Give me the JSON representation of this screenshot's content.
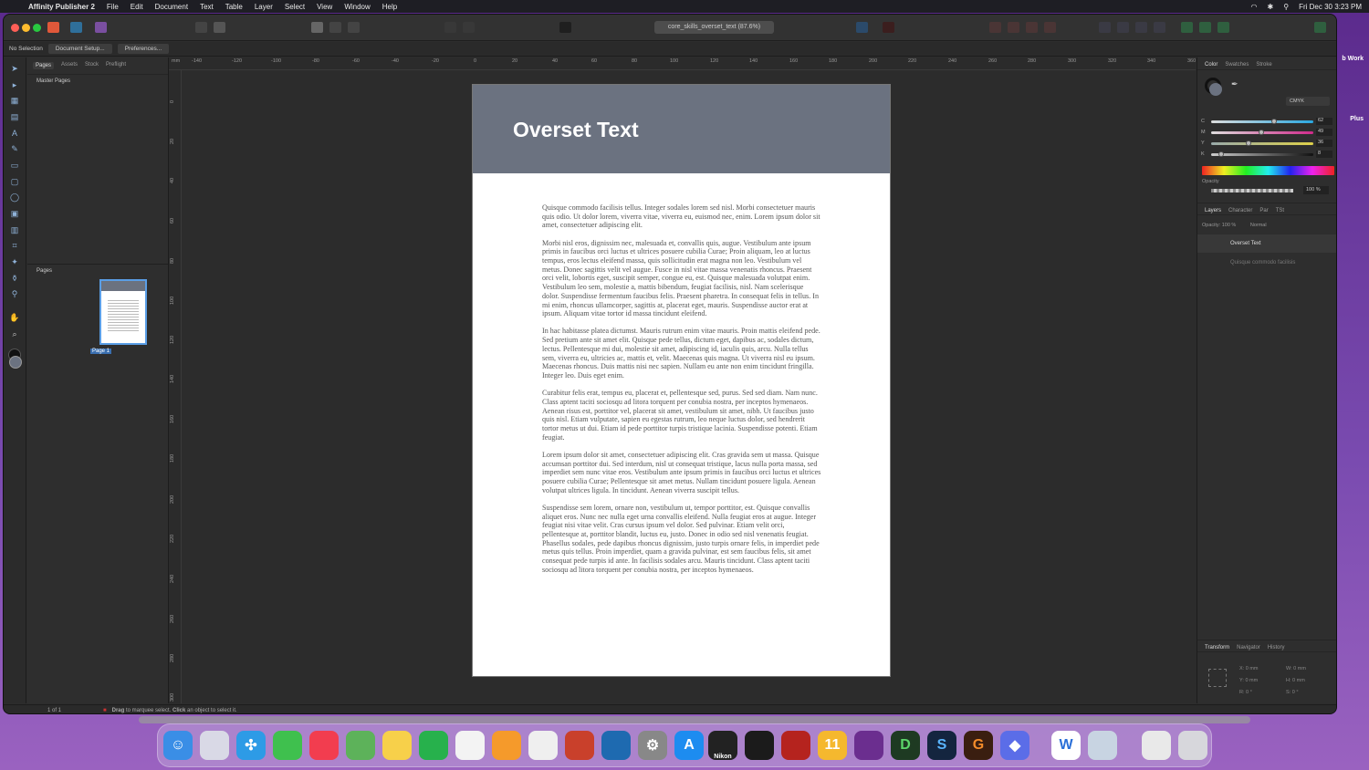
{
  "menubar": {
    "app": "Affinity Publisher 2",
    "items": [
      "File",
      "Edit",
      "Document",
      "Text",
      "Table",
      "Layer",
      "Select",
      "View",
      "Window",
      "Help"
    ],
    "clock": "Fri Dec 30  3:23 PM"
  },
  "desktop": {
    "labels": [
      "b Work",
      "Plus"
    ]
  },
  "toolbar": {
    "doc_title": "core_skills_overset_text (87.6%)"
  },
  "context": {
    "selection": "No Selection",
    "doc_setup": "Document Setup...",
    "preferences": "Preferences..."
  },
  "pages_panel": {
    "tabs": [
      "Pages",
      "Assets",
      "Stock",
      "Preflight"
    ],
    "master_pages": "Master Pages",
    "pages": "Pages",
    "page_label": "Page 1"
  },
  "ruler": {
    "unit": "mm",
    "h": [
      "-140",
      "-120",
      "-100",
      "-80",
      "-60",
      "-40",
      "-20",
      "0",
      "20",
      "40",
      "60",
      "80",
      "100",
      "120",
      "140",
      "160",
      "180",
      "200",
      "220",
      "240",
      "260",
      "280",
      "300",
      "320",
      "340",
      "360"
    ],
    "v": [
      "0",
      "20",
      "40",
      "60",
      "80",
      "100",
      "120",
      "140",
      "160",
      "180",
      "200",
      "220",
      "240",
      "260",
      "280",
      "300"
    ]
  },
  "document": {
    "title": "Overset Text",
    "paragraphs": [
      "Quisque commodo facilisis tellus. Integer sodales lorem sed nisl. Morbi consectetuer mauris quis odio. Ut dolor lorem, viverra vitae, viverra eu, euismod nec, enim. Lorem ipsum dolor sit amet, consectetuer adipiscing elit.",
      "Morbi nisl eros, dignissim nec, malesuada et, convallis quis, augue. Vestibulum ante ipsum primis in faucibus orci luctus et ultrices posuere cubilia Curae; Proin aliquam, leo at luctus tempus, eros lectus eleifend massa, quis sollicitudin erat magna non leo. Vestibulum vel metus. Donec sagittis velit vel augue. Fusce in nisl vitae massa venenatis rhoncus. Praesent orci velit, lobortis eget, suscipit semper, congue eu, est. Quisque malesuada volutpat enim. Vestibulum leo sem, molestie a, mattis bibendum, feugiat facilisis, nisl. Nam scelerisque dolor. Suspendisse fermentum faucibus felis. Praesent pharetra. In consequat felis in tellus. In mi enim, rhoncus ullamcorper, sagittis at, placerat eget, mauris. Suspendisse auctor erat at ipsum. Aliquam vitae tortor id massa tincidunt eleifend.",
      "In hac habitasse platea dictumst. Mauris rutrum enim vitae mauris. Proin mattis eleifend pede. Sed pretium ante sit amet elit. Quisque pede tellus, dictum eget, dapibus ac, sodales dictum, lectus. Pellentesque mi dui, molestie sit amet, adipiscing id, iaculis quis, arcu. Nulla tellus sem, viverra eu, ultricies ac, mattis et, velit. Maecenas quis magna. Ut viverra nisl eu ipsum. Maecenas rhoncus. Duis mattis nisi nec sapien. Nullam eu ante non enim tincidunt fringilla. Integer leo. Duis eget enim.",
      "Curabitur felis erat, tempus eu, placerat et, pellentesque sed, purus. Sed sed diam. Nam nunc. Class aptent taciti sociosqu ad litora torquent per conubia nostra, per inceptos hymenaeos. Aenean risus est, porttitor vel, placerat sit amet, vestibulum sit amet, nibh. Ut faucibus justo quis nisl. Etiam vulputate, sapien eu egestas rutrum, leo neque luctus dolor, sed hendrerit tortor metus ut dui. Etiam id pede porttitor turpis tristique lacinia. Suspendisse potenti. Etiam feugiat.",
      "Lorem ipsum dolor sit amet, consectetuer adipiscing elit. Cras gravida sem ut massa. Quisque accumsan porttitor dui. Sed interdum, nisl ut consequat tristique, lacus nulla porta massa, sed imperdiet sem nunc vitae eros. Vestibulum ante ipsum primis in faucibus orci luctus et ultrices posuere cubilia Curae; Pellentesque sit amet metus. Nullam tincidunt posuere ligula. Aenean volutpat ultrices ligula. In tincidunt. Aenean viverra suscipit tellus.",
      "Suspendisse sem lorem, ornare non, vestibulum ut, tempor porttitor, est. Quisque convallis aliquet eros. Nunc nec nulla eget urna convallis eleifend. Nulla feugiat eros at augue. Integer feugiat nisi vitae velit. Cras cursus ipsum vel dolor. Sed pulvinar. Etiam velit orci, pellentesque at, porttitor blandit, luctus eu, justo. Donec in odio sed nisl venenatis feugiat. Phasellus sodales, pede dapibus rhoncus dignissim, justo turpis ornare felis, in imperdiet pede metus quis tellus. Proin imperdiet, quam a gravida pulvinar, est sem faucibus felis, sit amet consequat pede turpis id ante. In facilisis sodales arcu. Mauris tincidunt. Class aptent taciti sociosqu ad litora torquent per conubia nostra, per inceptos hymenaeos."
    ]
  },
  "color_panel": {
    "tabs": [
      "Color",
      "Swatches",
      "Stroke"
    ],
    "model": "CMYK",
    "c": "62",
    "m": "49",
    "y": "36",
    "k": "8",
    "opacity_label": "Opacity",
    "opacity": "100 %",
    "values_fraction": {
      "c": 0.62,
      "m": 0.49,
      "y": 0.36,
      "k": 0.08
    }
  },
  "layers_panel": {
    "tabs": [
      "Layers",
      "Character",
      "Par",
      "TSt"
    ],
    "opacity_label": "Opacity:",
    "opacity": "100 %",
    "blend": "Normal",
    "layers": [
      "Overset Text",
      "Quisque commodo facilisis"
    ]
  },
  "transform_panel": {
    "tabs": [
      "Transform",
      "Navigator",
      "History"
    ],
    "x": "X:",
    "y": "Y:",
    "w": "W:",
    "h": "H:",
    "r": "R:",
    "s": "S:",
    "x_val": "0 mm",
    "y_val": "0 mm",
    "w_val": "0 mm",
    "h_val": "0 mm",
    "r_val": "0 °",
    "s_val": "0 °"
  },
  "status": {
    "page_count": "1 of 1",
    "hint_bold1": "Drag",
    "hint1": " to marquee select. ",
    "hint_bold2": "Click",
    "hint2": " an object to select it."
  },
  "dock": {
    "icons": [
      "finder-icon",
      "launchpad-icon",
      "safari-icon",
      "messages-icon",
      "news-icon",
      "maps-icon",
      "notes-icon",
      "numbers-icon",
      "reminders-icon",
      "pages-icon",
      "textedit-icon",
      "affinity-publisher-icon",
      "affinity-designer-icon",
      "system-settings-icon",
      "app-store-icon",
      "nikon-icon",
      "davinci-icon",
      "photo-booth-icon",
      "eleven-icon",
      "affinity-photo-icon",
      "d-icon",
      "s-icon",
      "g-icon",
      "gem-icon",
      "w-icon",
      "preview-icon",
      "documents-icon",
      "trash-icon"
    ],
    "letters": {
      "eleven": "11",
      "d": "D",
      "s": "S",
      "g": "G",
      "w": "W",
      "nikon": "Nikon"
    }
  }
}
